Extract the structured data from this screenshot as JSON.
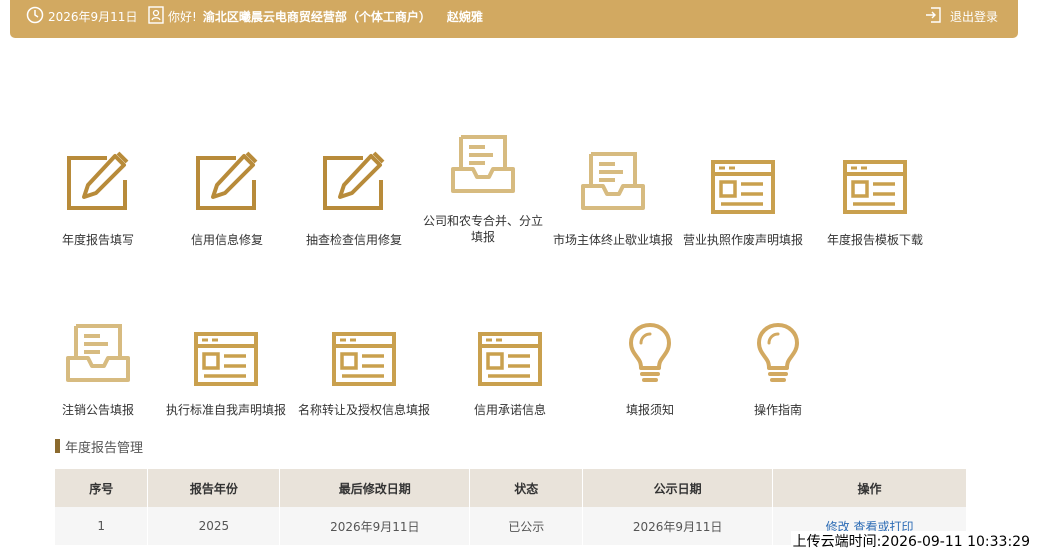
{
  "header": {
    "date": "2026年9月11日",
    "greeting": "你好!",
    "company": "渝北区曦晨云电商贸经营部（个体工商户）",
    "user_name": "赵婉雅",
    "logout_label": "退出登录"
  },
  "functions": [
    {
      "label": "年度报告填写",
      "icon": "pencil-square-icon"
    },
    {
      "label": "信用信息修复",
      "icon": "pencil-square-icon"
    },
    {
      "label": "抽查检查信用修复",
      "icon": "pencil-square-icon"
    },
    {
      "label": "公司和农专合并、分立填报",
      "icon": "inbox-tray-icon"
    },
    {
      "label": "市场主体终止歇业填报",
      "icon": "inbox-tray-icon"
    },
    {
      "label": "营业执照作废声明填报",
      "icon": "browser-form-icon"
    },
    {
      "label": "年度报告模板下载",
      "icon": "browser-form-icon"
    },
    {
      "label": "注销公告填报",
      "icon": "inbox-tray-icon"
    },
    {
      "label": "执行标准自我声明填报",
      "icon": "browser-form-icon"
    },
    {
      "label": "名称转让及授权信息填报",
      "icon": "browser-form-icon"
    },
    {
      "label": "信用承诺信息",
      "icon": "browser-form-icon"
    },
    {
      "label": "填报须知",
      "icon": "lightbulb-icon"
    },
    {
      "label": "操作指南",
      "icon": "lightbulb-icon"
    }
  ],
  "section": {
    "title": "年度报告管理"
  },
  "table": {
    "headers": [
      "序号",
      "报告年份",
      "最后修改日期",
      "状态",
      "公示日期",
      "操作"
    ],
    "rows": [
      {
        "index": "1",
        "year": "2025",
        "modified": "2026年9月11日",
        "status": "已公示",
        "publish_date": "2026年9月11日",
        "action_edit": "修改",
        "action_view": "查看或打印"
      }
    ]
  },
  "footer": {
    "upload_time": "上传云端时间:2026-09-11 10:33:29"
  },
  "colors": {
    "accent": "#d2a961",
    "icon": "#c9a04e",
    "section_bar": "#8b6a2e",
    "link": "#2d6cb5"
  }
}
